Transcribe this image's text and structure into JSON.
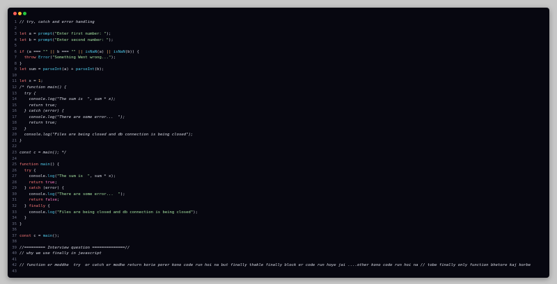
{
  "window": {
    "controls": [
      "close",
      "minimize",
      "maximize"
    ],
    "colors": {
      "background": "#070710",
      "keyword": "#ff7a7a",
      "function": "#4fc8e8",
      "string": "#a6e3a1",
      "comment": "#d8dae5"
    }
  },
  "code_lines": [
    {
      "n": "1",
      "t": "// try, catch and error handling",
      "k": "cm"
    },
    {
      "n": "2",
      "t": "",
      "k": "tx"
    },
    {
      "n": "3",
      "segs": [
        [
          "kw",
          "let"
        ],
        [
          "tx",
          " a = "
        ],
        [
          "fn",
          "prompt"
        ],
        [
          "tx",
          "("
        ],
        [
          "str",
          "\"Enter first number: \""
        ],
        [
          "tx",
          ");"
        ]
      ]
    },
    {
      "n": "4",
      "segs": [
        [
          "kw",
          "let"
        ],
        [
          "tx",
          " b = "
        ],
        [
          "fn",
          "prompt"
        ],
        [
          "tx",
          "("
        ],
        [
          "str",
          "\"Enter second number: \""
        ],
        [
          "tx",
          ");"
        ]
      ]
    },
    {
      "n": "5",
      "t": "",
      "k": "tx"
    },
    {
      "n": "6",
      "segs": [
        [
          "kw",
          "if"
        ],
        [
          "tx",
          " (a === "
        ],
        [
          "str",
          "\"\""
        ],
        [
          "tx",
          " "
        ],
        [
          "op",
          "||"
        ],
        [
          "tx",
          " b === "
        ],
        [
          "str",
          "\"\""
        ],
        [
          "tx",
          " "
        ],
        [
          "op",
          "||"
        ],
        [
          "tx",
          " "
        ],
        [
          "fn",
          "isNaN"
        ],
        [
          "tx",
          "(a) "
        ],
        [
          "op",
          "||"
        ],
        [
          "tx",
          " "
        ],
        [
          "fn",
          "isNaN"
        ],
        [
          "tx",
          "(b)) {"
        ]
      ]
    },
    {
      "n": "7",
      "segs": [
        [
          "tx",
          "  "
        ],
        [
          "kw",
          "throw"
        ],
        [
          "tx",
          " "
        ],
        [
          "fn",
          "Error"
        ],
        [
          "tx",
          "("
        ],
        [
          "str",
          "\"Something Went wrong...\""
        ],
        [
          "tx",
          ");"
        ]
      ]
    },
    {
      "n": "8",
      "t": "}",
      "k": "tx"
    },
    {
      "n": "9",
      "segs": [
        [
          "kw",
          "let"
        ],
        [
          "tx",
          " sum = "
        ],
        [
          "fn",
          "parseInt"
        ],
        [
          "tx",
          "(a) + "
        ],
        [
          "fn",
          "parseInt"
        ],
        [
          "tx",
          "(b);"
        ]
      ]
    },
    {
      "n": "10",
      "t": "",
      "k": "tx"
    },
    {
      "n": "11",
      "segs": [
        [
          "kw",
          "let"
        ],
        [
          "tx",
          " x = "
        ],
        [
          "op",
          "1"
        ],
        [
          "tx",
          ";"
        ]
      ]
    },
    {
      "n": "12",
      "t": "/* function main() {",
      "k": "cm"
    },
    {
      "n": "13",
      "t": "  try {",
      "k": "cm"
    },
    {
      "n": "14",
      "t": "    console.log(\"The sum is  \", sum * x);",
      "k": "cm"
    },
    {
      "n": "15",
      "t": "    return true;",
      "k": "cm"
    },
    {
      "n": "16",
      "t": "  } catch (error) {",
      "k": "cm"
    },
    {
      "n": "17",
      "t": "    console.log(\"There are some error...  \");",
      "k": "cm"
    },
    {
      "n": "18",
      "t": "    return true;",
      "k": "cm"
    },
    {
      "n": "19",
      "t": "  }",
      "k": "cm"
    },
    {
      "n": "20",
      "t": "  console.log(\"Files are being closed and db connection is being closed\");",
      "k": "cm"
    },
    {
      "n": "21",
      "t": "}",
      "k": "cm"
    },
    {
      "n": "22",
      "t": "",
      "k": "tx"
    },
    {
      "n": "23",
      "t": "const c = main(); */",
      "k": "cm"
    },
    {
      "n": "24",
      "t": "",
      "k": "tx"
    },
    {
      "n": "25",
      "segs": [
        [
          "kw",
          "function"
        ],
        [
          "tx",
          " "
        ],
        [
          "fn",
          "main"
        ],
        [
          "tx",
          "() {"
        ]
      ]
    },
    {
      "n": "26",
      "segs": [
        [
          "tx",
          "  "
        ],
        [
          "kw",
          "try"
        ],
        [
          "tx",
          " {"
        ]
      ]
    },
    {
      "n": "27",
      "segs": [
        [
          "tx",
          "    console."
        ],
        [
          "fn",
          "log"
        ],
        [
          "tx",
          "("
        ],
        [
          "str",
          "\"The sum is  \""
        ],
        [
          "tx",
          ", sum * x);"
        ]
      ]
    },
    {
      "n": "28",
      "segs": [
        [
          "tx",
          "    "
        ],
        [
          "kw",
          "return"
        ],
        [
          "tx",
          " "
        ],
        [
          "bool",
          "true"
        ],
        [
          "tx",
          ";"
        ]
      ]
    },
    {
      "n": "29",
      "segs": [
        [
          "tx",
          "  } "
        ],
        [
          "kw",
          "catch"
        ],
        [
          "tx",
          " (error) {"
        ]
      ]
    },
    {
      "n": "30",
      "segs": [
        [
          "tx",
          "    console."
        ],
        [
          "fn",
          "log"
        ],
        [
          "tx",
          "("
        ],
        [
          "str",
          "\"There are some error...  \""
        ],
        [
          "tx",
          ");"
        ]
      ]
    },
    {
      "n": "31",
      "segs": [
        [
          "tx",
          "    "
        ],
        [
          "kw",
          "return"
        ],
        [
          "tx",
          " "
        ],
        [
          "bool",
          "false"
        ],
        [
          "tx",
          ";"
        ]
      ]
    },
    {
      "n": "32",
      "segs": [
        [
          "tx",
          "  } "
        ],
        [
          "kw",
          "finally"
        ],
        [
          "tx",
          " {"
        ]
      ]
    },
    {
      "n": "33",
      "segs": [
        [
          "tx",
          "    console."
        ],
        [
          "fn",
          "log"
        ],
        [
          "tx",
          "("
        ],
        [
          "str",
          "\"Files are being closed and db connection is being closed\""
        ],
        [
          "tx",
          ");"
        ]
      ]
    },
    {
      "n": "34",
      "t": "  }",
      "k": "tx"
    },
    {
      "n": "35",
      "t": "}",
      "k": "tx"
    },
    {
      "n": "36",
      "t": "",
      "k": "tx"
    },
    {
      "n": "37",
      "segs": [
        [
          "kw",
          "const"
        ],
        [
          "tx",
          " c = "
        ],
        [
          "fn",
          "main"
        ],
        [
          "tx",
          "();"
        ]
      ]
    },
    {
      "n": "38",
      "t": "",
      "k": "tx"
    },
    {
      "n": "39",
      "t": "//========= Interview question ==============//",
      "k": "cm"
    },
    {
      "n": "40",
      "t": "// why we use finally in javascript",
      "k": "cm"
    },
    {
      "n": "41",
      "t": "",
      "k": "tx"
    },
    {
      "n": "42",
      "t": "// function er moddhe  try  or catch er modhe return korie porer kono code run hoi na but finally thakle finally block er code run hoye jai ....other kono code run hoi na // tobe finally only function bhetore kaj korbe",
      "k": "cm"
    },
    {
      "n": "43",
      "t": "",
      "k": "tx"
    }
  ]
}
